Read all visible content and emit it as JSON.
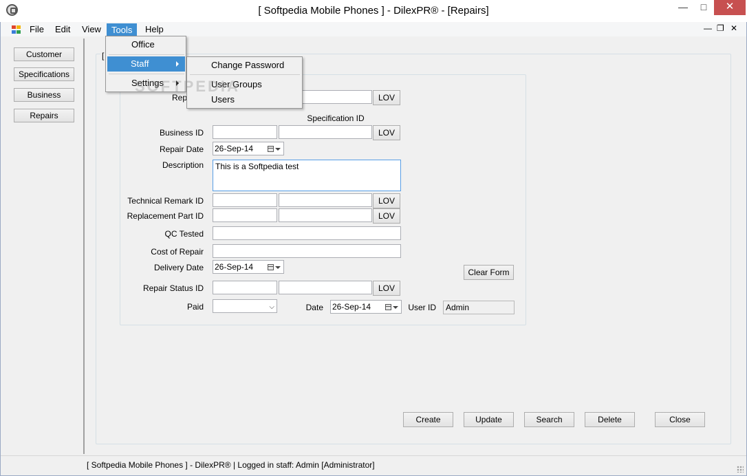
{
  "window": {
    "title": "[ Softpedia Mobile Phones ] - DilexPR® - [Repairs]",
    "minimize": "—",
    "maximize": "□",
    "close": "✕"
  },
  "menubar": {
    "items": [
      "File",
      "Edit",
      "View",
      "Tools",
      "Help"
    ],
    "mdi_min": "—",
    "mdi_restore": "❐",
    "mdi_close": "✕"
  },
  "sidebar": {
    "buttons": [
      "Customer",
      "Specifications",
      "Business",
      "Repairs"
    ]
  },
  "tools_menu": {
    "items": [
      "Office",
      "Staff",
      "Settings"
    ]
  },
  "staff_submenu": {
    "items": [
      "Change Password",
      "User Groups",
      "Users"
    ]
  },
  "form": {
    "group_label": "[",
    "repair_id_label": "Rep",
    "specification_id_header": "Specification ID",
    "business_id_label": "Business ID",
    "repair_date_label": "Repair Date",
    "repair_date_value": "26-Sep-14",
    "description_label": "Description",
    "description_value": "This is a Softpedia test",
    "technical_remark_id_label": "Technical Remark ID",
    "replacement_part_id_label": "Replacement Part ID",
    "qc_tested_label": "QC Tested",
    "cost_of_repair_label": "Cost of Repair",
    "delivery_date_label": "Delivery Date",
    "delivery_date_value": "26-Sep-14",
    "repair_status_id_label": "Repair Status ID",
    "paid_label": "Paid",
    "date_label": "Date",
    "date_value": "26-Sep-14",
    "user_id_label": "User ID",
    "user_id_value": "Admin",
    "lov_label": "LOV",
    "clear_form_label": "Clear Form"
  },
  "actions": {
    "create": "Create",
    "update": "Update",
    "search": "Search",
    "delete": "Delete",
    "close": "Close"
  },
  "watermark": "SOFTPEDIA",
  "status": {
    "text": "[ Softpedia Mobile Phones ] - DilexPR®   |   Logged in staff: Admin [Administrator]"
  },
  "colors": {
    "menu_highlight": "#3f8fd2",
    "close_button": "#c75050"
  }
}
